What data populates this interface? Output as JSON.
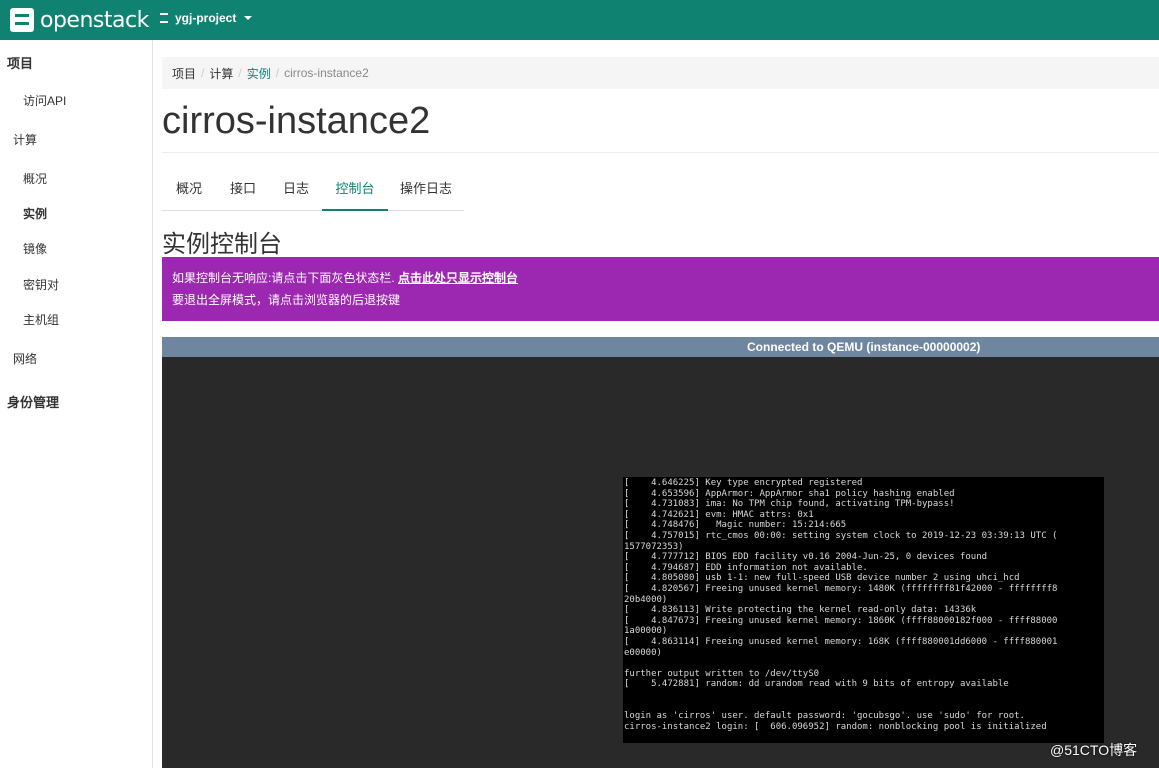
{
  "topbar": {
    "logo_text": "openstack",
    "project": "ygj-project"
  },
  "sidebar": {
    "project": "项目",
    "api_access": "访问API",
    "compute": "计算",
    "overview": "概况",
    "instances": "实例",
    "images": "镜像",
    "key_pairs": "密钥对",
    "server_groups": "主机组",
    "network": "网络",
    "identity": "身份管理"
  },
  "breadcrumb": {
    "items": [
      "项目",
      "计算",
      "实例",
      "cirros-instance2"
    ]
  },
  "page": {
    "title": "cirros-instance2",
    "tabs": [
      "概况",
      "接口",
      "日志",
      "控制台",
      "操作日志"
    ],
    "section_title": "实例控制台"
  },
  "alert": {
    "line1_text": "如果控制台无响应:请点击下面灰色状态栏. ",
    "line1_link": "点击此处只显示控制台",
    "line2_text": "要退出全屏模式，请点击浏览器的后退按键"
  },
  "console": {
    "status": "Connected to QEMU (instance-00000002)",
    "lines": [
      "[    4.646225] Key type encrypted registered",
      "[    4.653596] AppArmor: AppArmor sha1 policy hashing enabled",
      "[    4.731083] ima: No TPM chip found, activating TPM-bypass!",
      "[    4.742621] evm: HMAC attrs: 0x1",
      "[    4.748476]   Magic number: 15:214:665",
      "[    4.757015] rtc_cmos 00:00: setting system clock to 2019-12-23 03:39:13 UTC (",
      "1577072353)",
      "[    4.777712] BIOS EDD facility v0.16 2004-Jun-25, 0 devices found",
      "[    4.794687] EDD information not available.",
      "[    4.805080] usb 1-1: new full-speed USB device number 2 using uhci_hcd",
      "[    4.820567] Freeing unused kernel memory: 1480K (ffffffff81f42000 - ffffffff8",
      "20b4000)",
      "[    4.836113] Write protecting the kernel read-only data: 14336k",
      "[    4.847673] Freeing unused kernel memory: 1860K (ffff88000182f000 - ffff88000",
      "1a00000)",
      "[    4.863114] Freeing unused kernel memory: 168K (ffff880001dd6000 - ffff880001",
      "e00000)",
      "",
      "further output written to /dev/ttyS0",
      "[    5.472881] random: dd urandom read with 9 bits of entropy available",
      "",
      "",
      "login as 'cirros' user. default password: 'gocubsgo'. use 'sudo' for root.",
      "cirros-instance2 login: [  606.096952] random: nonblocking pool is initialized"
    ]
  },
  "watermark": "@51CTO博客"
}
